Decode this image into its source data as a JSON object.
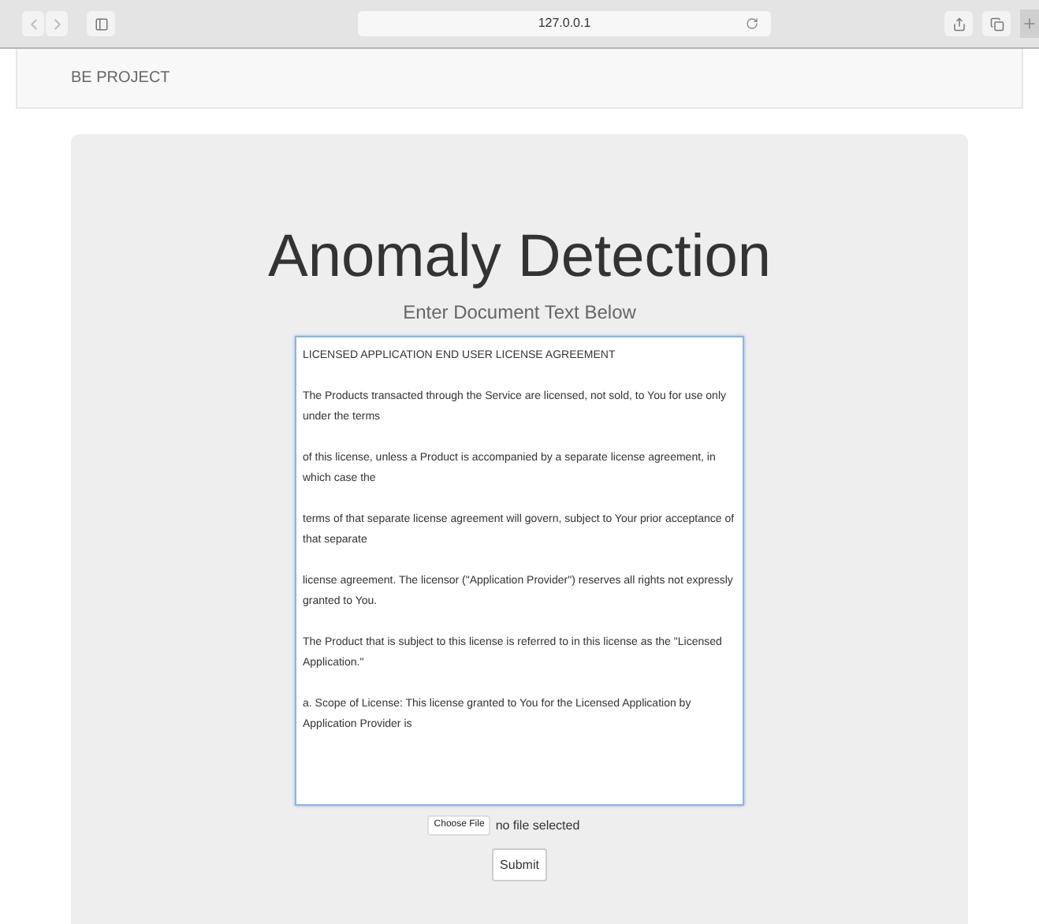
{
  "browser": {
    "address": "127.0.0.1"
  },
  "navbar": {
    "brand": "BE PROJECT"
  },
  "main": {
    "title": "Anomaly Detection",
    "subtitle": "Enter Document Text Below",
    "document_text": "LICENSED APPLICATION END USER LICENSE AGREEMENT\n\nThe Products transacted through the Service are licensed, not sold, to You for use only under the terms\n\nof this license, unless a Product is accompanied by a separate license agreement, in which case the\n\nterms of that separate license agreement will govern, subject to Your prior acceptance of that separate\n\nlicense agreement. The licensor (\"Application Provider\") reserves all rights not expressly granted to You.\n\nThe Product that is subject to this license is referred to in this license as the \"Licensed Application.\"\n\na. Scope of License: This license granted to You for the Licensed Application by Application Provider is",
    "file_button": "Choose File",
    "file_status": "no file selected",
    "submit": "Submit"
  }
}
